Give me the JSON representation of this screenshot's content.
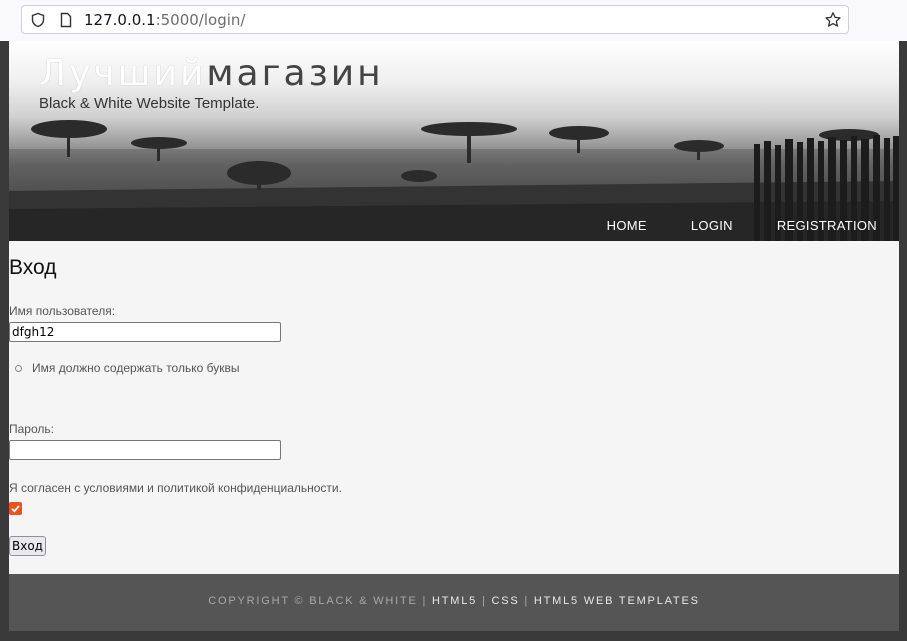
{
  "browser": {
    "url_host": "127.0.0.1",
    "url_rest": ":5000/login/"
  },
  "header": {
    "title_part1": "Лучший",
    "title_part2": "магазин",
    "subtitle": "Black & White Website Template.",
    "nav": [
      "HOME",
      "LOGIN",
      "REGISTRATION"
    ]
  },
  "form": {
    "heading": "Вход",
    "username_label": "Имя пользователя:",
    "username_value": "dfgh12",
    "username_error": "Имя должно содержать только буквы",
    "password_label": "Пароль:",
    "password_value": "",
    "terms_label": "Я согласен с условиями и политикой конфиденциальности.",
    "terms_checked": true,
    "submit_label": "Вход"
  },
  "footer": {
    "copyright": "COPYRIGHT © BLACK & WHITE",
    "sep": "|",
    "link1": "HTML5",
    "link2": "CSS",
    "link3": "HTML5 WEB TEMPLATES"
  },
  "colors": {
    "checkbox_accent": "#e95420",
    "footer_bg": "#555555"
  }
}
